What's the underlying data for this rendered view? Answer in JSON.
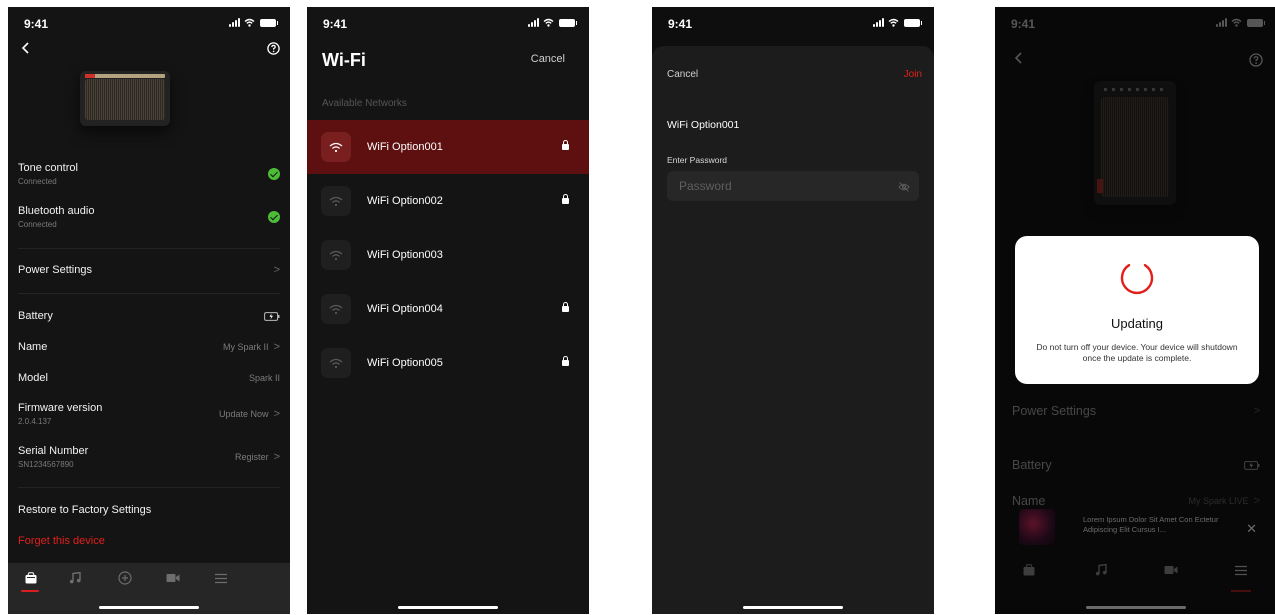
{
  "status_bar": {
    "time": "9:41"
  },
  "device_screen": {
    "rows": [
      {
        "label": "Tone control",
        "sub": "Connected"
      },
      {
        "label": "Bluetooth audio",
        "sub": "Connected"
      }
    ],
    "power_settings": "Power Settings",
    "battery": "Battery",
    "name_label": "Name",
    "name_value": "My Spark II",
    "model_label": "Model",
    "model_value": "Spark II",
    "firmware_label": "Firmware version",
    "firmware_sub": "2.0.4.137",
    "firmware_value": "Update Now",
    "serial_label": "Serial Number",
    "serial_sub": "SN1234567890",
    "serial_value": "Register",
    "restore": "Restore to Factory Settings",
    "forget": "Forget this device",
    "tabs": [
      "device-icon",
      "music-note-icon",
      "plus-circle-icon",
      "video-icon",
      "menu-icon"
    ]
  },
  "wifi_screen": {
    "title": "Wi-Fi",
    "cancel": "Cancel",
    "section": "Available Networks",
    "networks": [
      {
        "name": "WiFi Option001",
        "locked": true,
        "selected": true
      },
      {
        "name": "WiFi Option002",
        "locked": true,
        "selected": false
      },
      {
        "name": "WiFi Option003",
        "locked": false,
        "selected": false
      },
      {
        "name": "WiFi Option004",
        "locked": true,
        "selected": false
      },
      {
        "name": "WiFi Option005",
        "locked": true,
        "selected": false
      }
    ]
  },
  "password_screen": {
    "cancel": "Cancel",
    "join": "Join",
    "network": "WiFi Option001",
    "field_label": "Enter Password",
    "placeholder": "Password"
  },
  "update_screen": {
    "power_settings": "Power Settings",
    "battery": "Battery",
    "name_label": "Name",
    "name_value": "My Spark LIVE",
    "modal_title": "Updating",
    "modal_message": "Do not turn off your device. Your device will shutdown once the update is complete.",
    "mini_player_text": "Lorem Ipsum Dolor Sit Amet Con Ectetur Adipiscing Elit Cursus I..."
  },
  "colors": {
    "accent": "#e0201c",
    "success": "#4cbc37",
    "background": "#141414"
  }
}
